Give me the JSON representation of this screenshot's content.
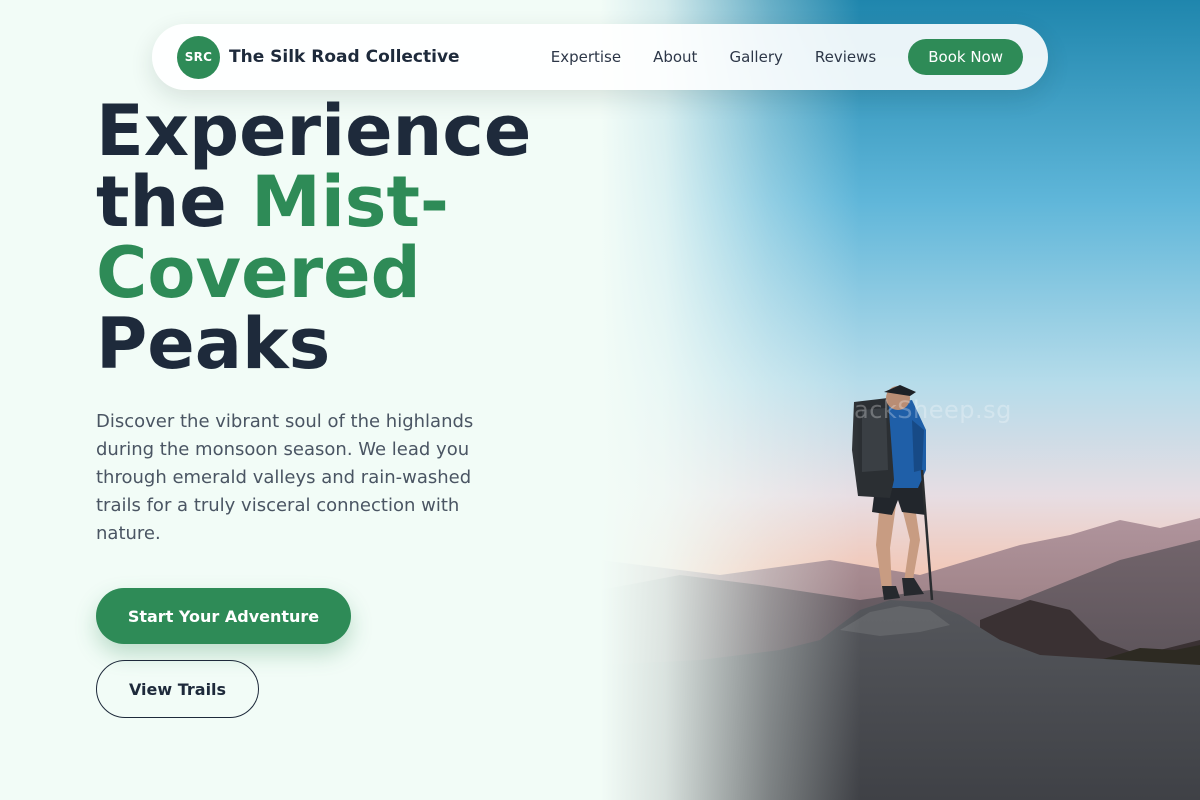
{
  "nav": {
    "logo_text": "SRC",
    "brand_name": "The Silk Road Collective",
    "links": [
      "Expertise",
      "About",
      "Gallery",
      "Reviews"
    ],
    "cta_label": "Book Now"
  },
  "hero": {
    "title_line1": "Experience",
    "title_line2_lead": "the ",
    "title_accent": "Mist-Covered",
    "title_line3": "Peaks",
    "description": "Discover the vibrant soul of the highlands during the monsoon season. We lead you through emerald valleys and rain-washed trails for a truly visceral connection with nature.",
    "primary_cta": "Start Your Adventure",
    "secondary_cta": "View Trails",
    "image_watermark": "ackSheep.sg"
  },
  "colors": {
    "brand_green": "#2e8b57",
    "heading_navy": "#1e2a3b",
    "page_background": "#f2fcf7"
  }
}
